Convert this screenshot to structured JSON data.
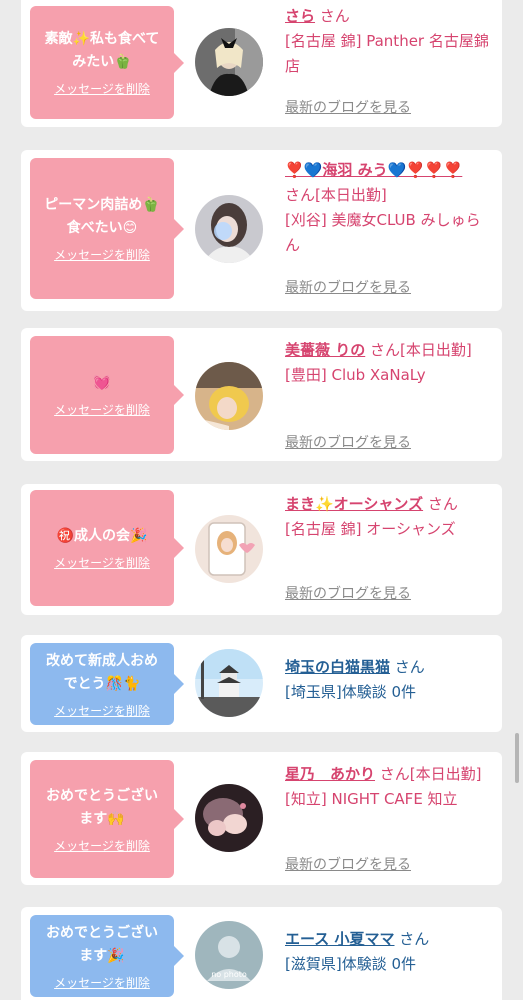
{
  "items": [
    {
      "theme": "pink",
      "message": "素敵✨私も食べて\nみたい🫑",
      "delete_label": "メッセージを削除",
      "name": "さら",
      "san": "さん",
      "shop": "[名古屋 錦] Panther 名古屋錦店",
      "blog_label": "最新のブログを見る",
      "avatar": "panther-photo"
    },
    {
      "theme": "pink",
      "message": "ピーマン肉詰め🫑\n食べたい😊",
      "delete_label": "メッセージを削除",
      "name": "❣️💙海羽 みう💙❣️❣️❣️",
      "san": "さん[本日出勤]",
      "shop": "[刈谷] 美魔女CLUB みしゅらん",
      "blog_label": "最新のブログを見る",
      "avatar": "blurred-photo"
    },
    {
      "theme": "pink",
      "message": "💓",
      "delete_label": "メッセージを削除",
      "name": "美薔薇 りの",
      "san": "さん[本日出勤]",
      "shop": "[豊田] Club XaNaLy",
      "blog_label": "最新のブログを見る",
      "avatar": "blonde-photo"
    },
    {
      "theme": "pink",
      "message": "㊗️成人の会🎉",
      "delete_label": "メッセージを削除",
      "name": "まき✨オーシャンズ",
      "san": "さん",
      "shop": "[名古屋 錦] オーシャンズ",
      "blog_label": "最新のブログを見る",
      "avatar": "phone-photo"
    },
    {
      "theme": "blue",
      "message": "改めて新成人おめ\nでとう🎊🐈",
      "delete_label": "メッセージを削除",
      "name": "埼玉の白猫黒猫",
      "san": "さん",
      "shop": "[埼玉県]体験談 0件",
      "blog_label": "",
      "avatar": "castle-photo"
    },
    {
      "theme": "pink",
      "message": "おめでとうござい\nます🙌",
      "delete_label": "メッセージを削除",
      "name": "星乃　あかり",
      "san": "さん[本日出勤]",
      "shop": "[知立] NIGHT CAFE 知立",
      "blog_label": "最新のブログを見る",
      "avatar": "hands-photo"
    },
    {
      "theme": "blue",
      "message": "おめでとうござい\nます🎉",
      "delete_label": "メッセージを削除",
      "name": "エース 小夏ママ",
      "san": "さん",
      "shop": "[滋賀県]体験談 0件",
      "blog_label": "",
      "avatar": "no-photo",
      "avatar_text": "no photo"
    }
  ]
}
